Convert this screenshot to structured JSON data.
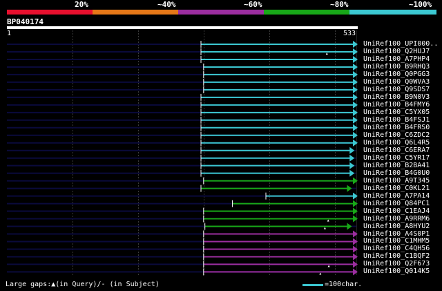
{
  "query": {
    "id": "BP040174",
    "start": "1",
    "end": "533",
    "length": 533
  },
  "scale_labels": [
    "20%",
    "~40%",
    "~60%",
    "~80%",
    "~100%"
  ],
  "scale_colors": [
    "#e8102e",
    "#e67818",
    "#9c2ea0",
    "#18a818",
    "#3cc8d2"
  ],
  "legend": {
    "gaps_text": "Large gaps:▲(in Query)/- (in Subject)",
    "scale_text": "=100char."
  },
  "hits": [
    {
      "label": "UniRef100_UPI000..",
      "start": 296,
      "end": 533,
      "color": "#3cc8d2",
      "query_gap": null
    },
    {
      "label": "UniRef100_Q2HUJ7",
      "start": 296,
      "end": 533,
      "color": "#3cc8d2",
      "query_gap": 488
    },
    {
      "label": "UniRef100_A7PHP4",
      "start": 296,
      "end": 533,
      "color": "#3cc8d2",
      "query_gap": null
    },
    {
      "label": "UniRef100_B9RHQ3",
      "start": 300,
      "end": 533,
      "color": "#3cc8d2",
      "query_gap": null
    },
    {
      "label": "UniRef100_Q0PGG3",
      "start": 300,
      "end": 533,
      "color": "#3cc8d2",
      "query_gap": null
    },
    {
      "label": "UniRef100_Q0WVA3",
      "start": 300,
      "end": 533,
      "color": "#3cc8d2",
      "query_gap": null
    },
    {
      "label": "UniRef100_Q9SDS7",
      "start": 300,
      "end": 533,
      "color": "#3cc8d2",
      "query_gap": null
    },
    {
      "label": "UniRef100_B9N0V3",
      "start": 296,
      "end": 533,
      "color": "#3cc8d2",
      "query_gap": null
    },
    {
      "label": "UniRef100_B4FMY6",
      "start": 296,
      "end": 533,
      "color": "#3cc8d2",
      "query_gap": null
    },
    {
      "label": "UniRef100_C5YX05",
      "start": 296,
      "end": 533,
      "color": "#3cc8d2",
      "query_gap": null
    },
    {
      "label": "UniRef100_B4FSJ1",
      "start": 296,
      "end": 533,
      "color": "#3cc8d2",
      "query_gap": null
    },
    {
      "label": "UniRef100_B4FRS0",
      "start": 296,
      "end": 533,
      "color": "#3cc8d2",
      "query_gap": null
    },
    {
      "label": "UniRef100_C6ZDC2",
      "start": 296,
      "end": 533,
      "color": "#3cc8d2",
      "query_gap": null
    },
    {
      "label": "UniRef100_Q6L4R5",
      "start": 296,
      "end": 533,
      "color": "#3cc8d2",
      "query_gap": null
    },
    {
      "label": "UniRef100_C6ERA7",
      "start": 296,
      "end": 528,
      "color": "#3cc8d2",
      "query_gap": null
    },
    {
      "label": "UniRef100_C5YR17",
      "start": 296,
      "end": 528,
      "color": "#3cc8d2",
      "query_gap": null
    },
    {
      "label": "UniRef100_B2BA41",
      "start": 296,
      "end": 528,
      "color": "#3cc8d2",
      "query_gap": null
    },
    {
      "label": "UniRef100_B4G0U0",
      "start": 296,
      "end": 528,
      "color": "#3cc8d2",
      "query_gap": null
    },
    {
      "label": "UniRef100_A9T345",
      "start": 300,
      "end": 533,
      "color": "#18a818",
      "query_gap": null
    },
    {
      "label": "UniRef100_C0KL21",
      "start": 296,
      "end": 524,
      "color": "#18a818",
      "query_gap": null
    },
    {
      "label": "UniRef100_A7PA14",
      "start": 395,
      "end": 533,
      "color": "#3cc8d2",
      "query_gap": null
    },
    {
      "label": "UniRef100_Q84PC1",
      "start": 344,
      "end": 533,
      "color": "#18a818",
      "query_gap": null
    },
    {
      "label": "UniRef100_C1EAJ4",
      "start": 300,
      "end": 533,
      "color": "#18a818",
      "query_gap": null
    },
    {
      "label": "UniRef100_A9RRM6",
      "start": 300,
      "end": 533,
      "color": "#18a818",
      "query_gap": 490
    },
    {
      "label": "UniRef100_A8HYU2",
      "start": 302,
      "end": 524,
      "color": "#18a818",
      "query_gap": 485
    },
    {
      "label": "UniRef100_A4S0P1",
      "start": 300,
      "end": 533,
      "color": "#9c2ea0",
      "query_gap": null
    },
    {
      "label": "UniRef100_C1MHM5",
      "start": 300,
      "end": 533,
      "color": "#9c2ea0",
      "query_gap": null
    },
    {
      "label": "UniRef100_C4QH56",
      "start": 300,
      "end": 533,
      "color": "#9c2ea0",
      "query_gap": null
    },
    {
      "label": "UniRef100_C1BQF2",
      "start": 300,
      "end": 533,
      "color": "#9c2ea0",
      "query_gap": null
    },
    {
      "label": "UniRef100_Q2F673",
      "start": 300,
      "end": 533,
      "color": "#9c2ea0",
      "query_gap": 491
    },
    {
      "label": "UniRef100_Q014K5",
      "start": 300,
      "end": 533,
      "color": "#9c2ea0",
      "query_gap": 478
    }
  ]
}
